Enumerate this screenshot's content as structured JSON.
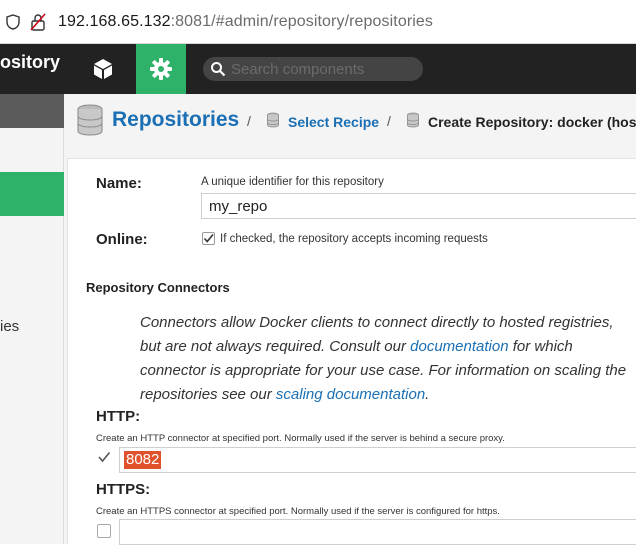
{
  "browser": {
    "url_host": "192.168.65.132",
    "url_rest": ":8081/#admin/repository/repositories"
  },
  "header": {
    "brand": "ository",
    "search_placeholder": "Search components",
    "accent_color": "#2eb26a"
  },
  "sidebar": {
    "partial_item": "ies"
  },
  "breadcrumb": {
    "title": "Repositories",
    "sep": "/",
    "recipe": "Select Recipe",
    "create": "Create Repository: docker (hoste"
  },
  "form": {
    "name_label": "Name:",
    "name_help": "A unique identifier for this repository",
    "name_value": "my_repo",
    "online_label": "Online:",
    "online_help": "If checked, the repository accepts incoming requests",
    "online_checked": true,
    "connectors_title": "Repository Connectors",
    "info_text_1": "Connectors allow Docker clients to connect directly to hosted registries, but are not always required. Consult our ",
    "info_link_1": "documentation",
    "info_text_2": " for which connector is appropriate for your use case. For information on scaling the repositories see our ",
    "info_link_2": "scaling documentation",
    "info_text_3": ".",
    "http_label": "HTTP:",
    "http_help": "Create an HTTP connector at specified port. Normally used if the server is behind a secure proxy.",
    "http_checked": true,
    "http_value": "8082",
    "https_label": "HTTPS:",
    "https_help": "Create an HTTPS connector at specified port. Normally used if the server is configured for https.",
    "https_checked": false
  }
}
